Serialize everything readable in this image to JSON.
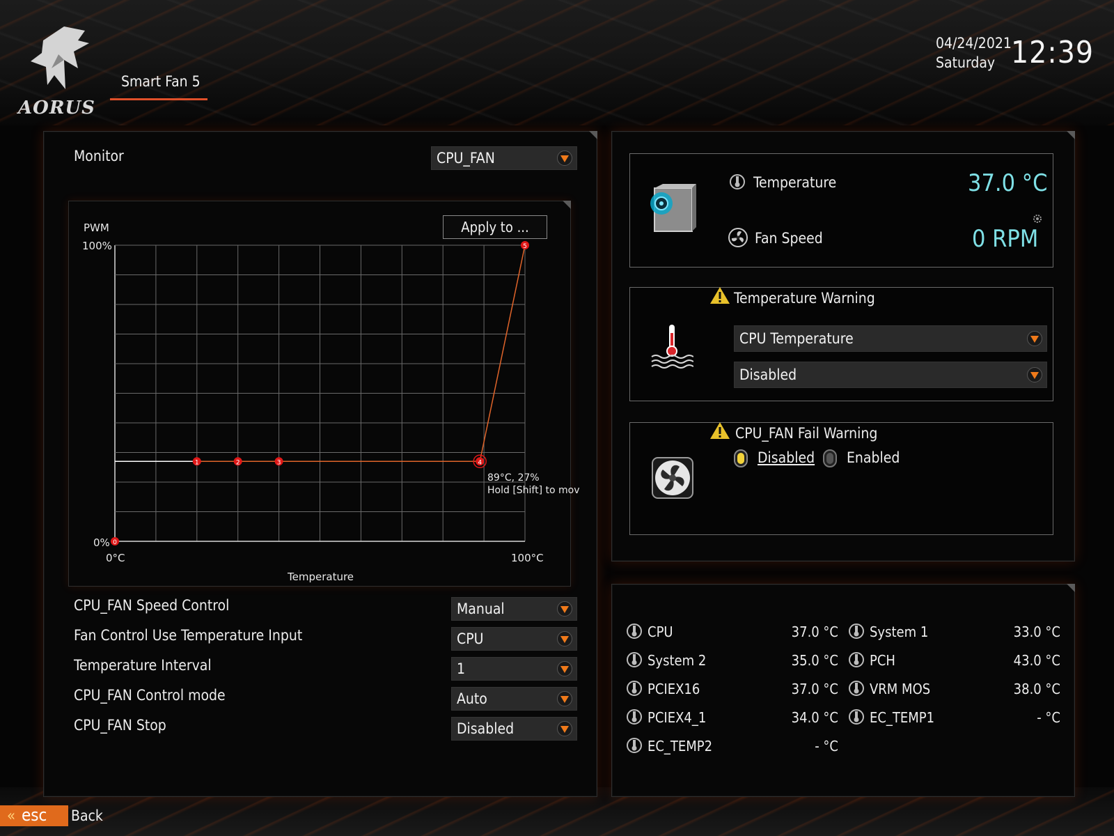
{
  "header": {
    "logo_text": "AORUS",
    "tab_title": "Smart Fan 5",
    "date": "04/24/2021",
    "weekday": "Saturday",
    "time": "12:39"
  },
  "left": {
    "monitor_label": "Monitor",
    "monitor_value": "CPU_FAN",
    "apply_button": "Apply to ...",
    "chart_tooltip_line1": "89°C, 27%",
    "chart_tooltip_line2": "Hold [Shift] to mov",
    "settings": [
      {
        "label": "CPU_FAN Speed Control",
        "value": "Manual"
      },
      {
        "label": "Fan Control Use Temperature Input",
        "value": "CPU"
      },
      {
        "label": "Temperature Interval",
        "value": "1"
      },
      {
        "label": "CPU_FAN Control mode",
        "value": "Auto"
      },
      {
        "label": "CPU_FAN Stop",
        "value": "Disabled"
      }
    ]
  },
  "chart_data": {
    "type": "line",
    "ylabel": "PWM",
    "xlabel": "Temperature",
    "x_tick_labels": [
      "0°C",
      "100°C"
    ],
    "y_tick_labels": [
      "0%",
      "100%"
    ],
    "xlim": [
      0,
      100
    ],
    "ylim": [
      0,
      100
    ],
    "grid": true,
    "points": [
      {
        "label": "0",
        "x": 0,
        "y": 0
      },
      {
        "label": "1",
        "x": 20,
        "y": 27
      },
      {
        "label": "2",
        "x": 30,
        "y": 27
      },
      {
        "label": "3",
        "x": 40,
        "y": 27
      },
      {
        "label": "4",
        "x": 89,
        "y": 27
      },
      {
        "label": "5",
        "x": 100,
        "y": 100
      }
    ],
    "line_color": "#e0642a",
    "marker_color": "#e01818"
  },
  "status": {
    "temperature_label": "Temperature",
    "temperature_value": "37.0 °C",
    "fan_speed_label": "Fan Speed",
    "fan_speed_value": "0 RPM",
    "value_color": "#7fe0e6"
  },
  "temp_warning": {
    "title": "Temperature Warning",
    "source": "CPU Temperature",
    "value": "Disabled"
  },
  "fan_fail_warning": {
    "title": "CPU_FAN Fail Warning",
    "option_disabled": "Disabled",
    "option_enabled": "Enabled",
    "selected": "Disabled"
  },
  "sensors": [
    {
      "name": "CPU",
      "value": "37.0 °C"
    },
    {
      "name": "System 1",
      "value": "33.0 °C"
    },
    {
      "name": "System 2",
      "value": "35.0 °C"
    },
    {
      "name": "PCH",
      "value": "43.0 °C"
    },
    {
      "name": "PCIEX16",
      "value": "37.0 °C"
    },
    {
      "name": "VRM MOS",
      "value": "38.0 °C"
    },
    {
      "name": "PCIEX4_1",
      "value": "34.0 °C"
    },
    {
      "name": "EC_TEMP1",
      "value": "- °C"
    },
    {
      "name": "EC_TEMP2",
      "value": "- °C"
    }
  ],
  "footer": {
    "esc_label": "esc",
    "back_label": "Back"
  },
  "accent_color": "#e06a1c"
}
